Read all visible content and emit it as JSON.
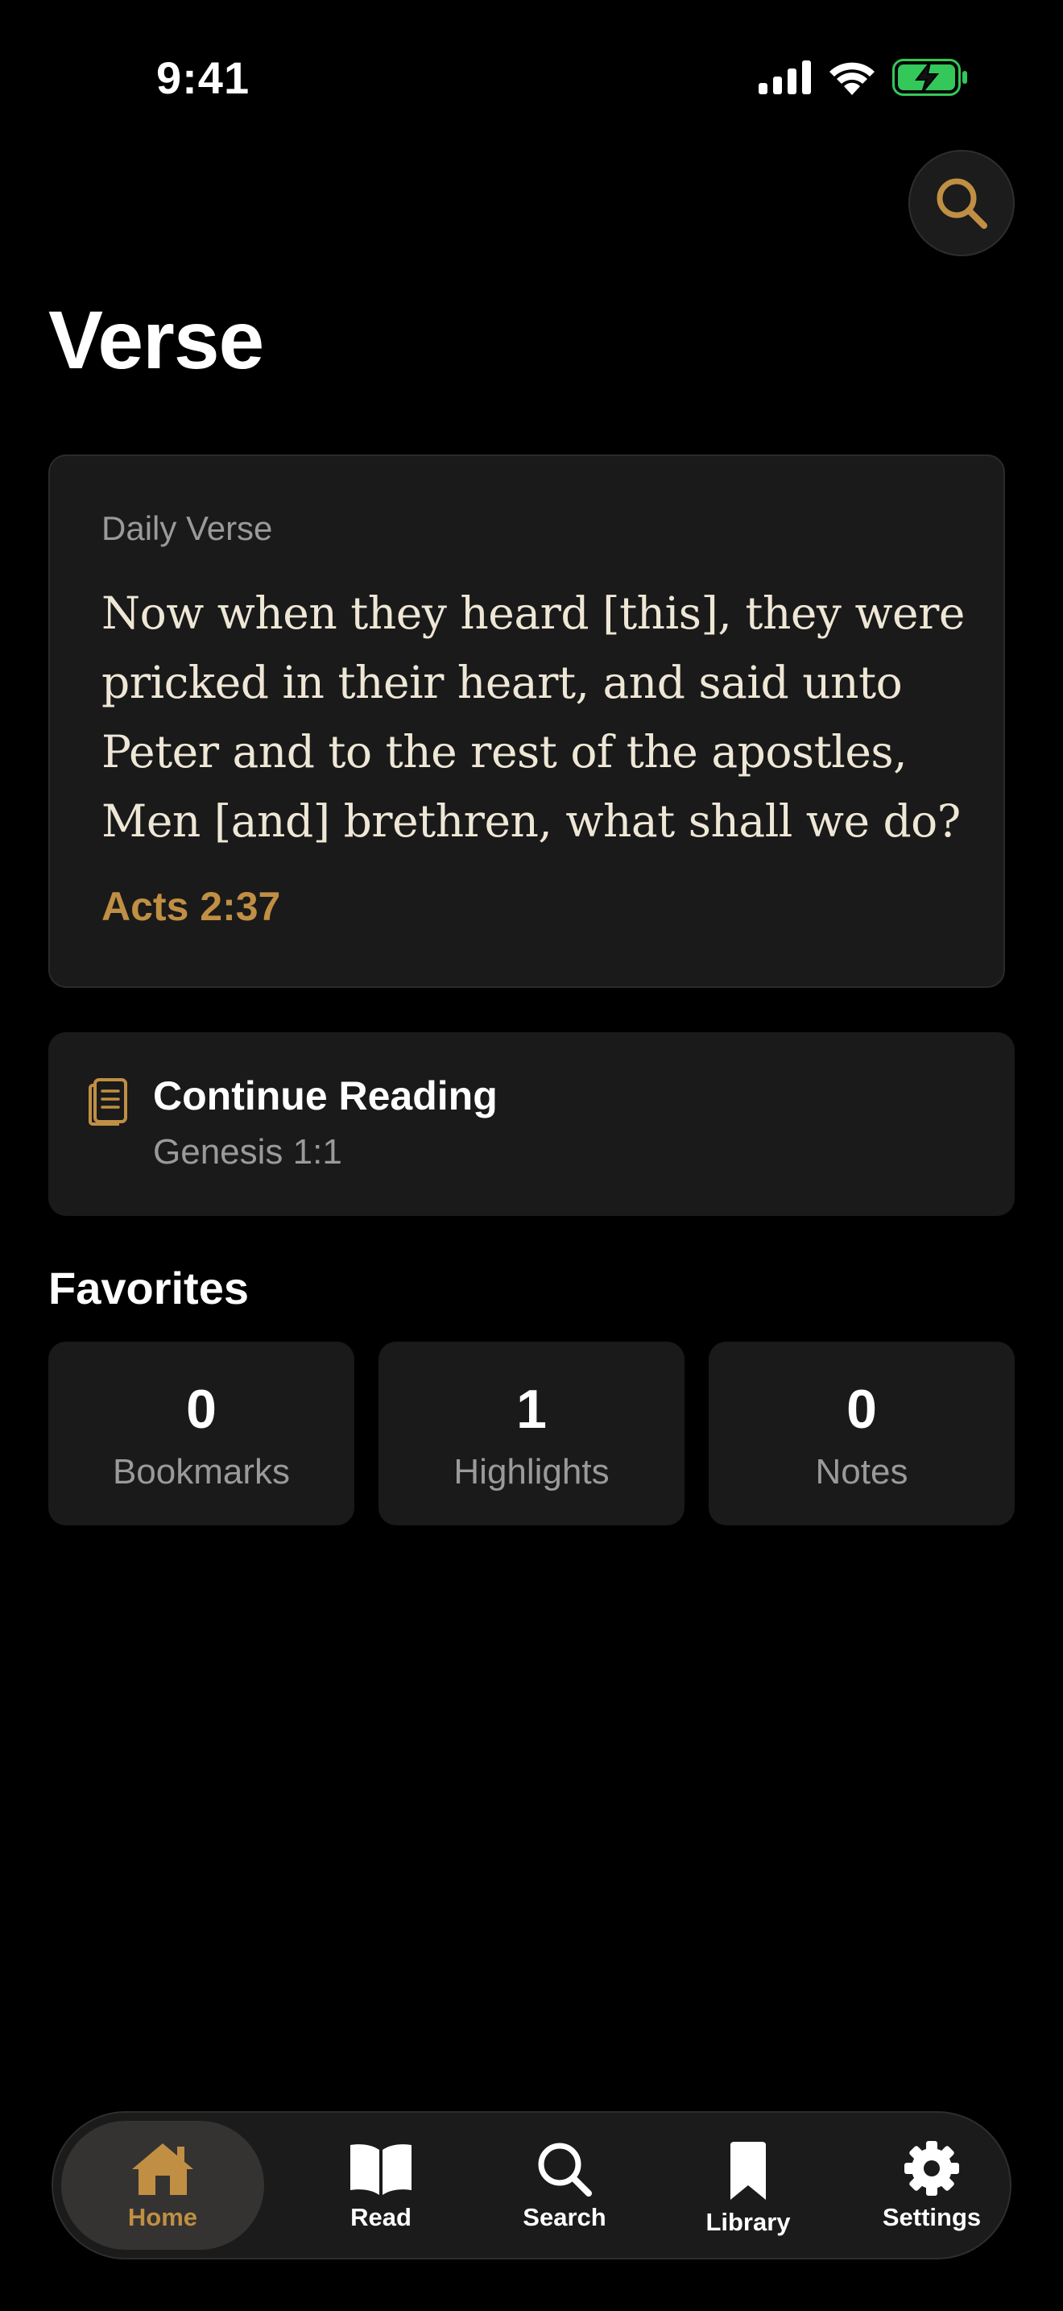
{
  "status_bar": {
    "time": "9:41",
    "icons": [
      "signal-icon",
      "wifi-icon",
      "battery-charging-icon"
    ],
    "battery_color": "#34c759"
  },
  "header": {
    "title": "Verse",
    "search_icon": "search-icon"
  },
  "daily_verse": {
    "label": "Daily Verse",
    "text": "Now when they heard [this], they were pricked in their heart, and said unto Peter and to the rest of the apostles, Men [and] brethren, what shall we do?",
    "reference": "Acts 2:37"
  },
  "continue_reading": {
    "icon": "book-page-icon",
    "title": "Continue Reading",
    "location": "Genesis 1:1"
  },
  "favorites": {
    "title": "Favorites",
    "stats": [
      {
        "value": "0",
        "label": "Bookmarks"
      },
      {
        "value": "1",
        "label": "Highlights"
      },
      {
        "value": "0",
        "label": "Notes"
      }
    ]
  },
  "tabbar": {
    "tabs": [
      {
        "label": "Home",
        "icon": "home-icon",
        "active": true
      },
      {
        "label": "Read",
        "icon": "open-book-icon",
        "active": false
      },
      {
        "label": "Search",
        "icon": "search-icon",
        "active": false
      },
      {
        "label": "Library",
        "icon": "bookmark-icon",
        "active": false
      },
      {
        "label": "Settings",
        "icon": "gear-icon",
        "active": false
      }
    ]
  },
  "colors": {
    "accent": "#c08f44",
    "background": "#000000",
    "card": "#1a1a1a",
    "verse_text": "#efe7d6",
    "muted_text": "#9a9a9a"
  }
}
